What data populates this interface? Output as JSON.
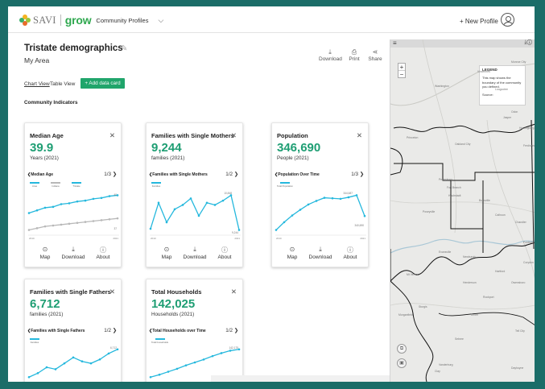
{
  "header": {
    "logo_savi": "SAVI",
    "logo_grow": "grow",
    "app_name": "Community Profiles",
    "new_profile": "+ New Profile"
  },
  "profile": {
    "title": "Tristate demographics",
    "subtitle": "My Area"
  },
  "toolbar": {
    "download": "Download",
    "print": "Print",
    "share": "Share"
  },
  "views": {
    "chart_view": "Chart View",
    "table_view": "Table View",
    "add_card": "+ Add data card"
  },
  "section_title": "Community Indicators",
  "card_actions": {
    "map": "Map",
    "download": "Download",
    "about": "About"
  },
  "cards": [
    {
      "title": "Median Age",
      "value": "39.9",
      "unit": "Years (2021)",
      "subchart": "Median Age",
      "pager": "1/3",
      "legend": [
        "Area",
        "Indiana",
        "Tristate"
      ],
      "end_label": "40",
      "end_label2": "37",
      "x_start": "2010",
      "x_end": "2021"
    },
    {
      "title": "Families with Single Mothers",
      "value": "9,244",
      "unit": "families (2021)",
      "subchart": "Families with Single Mothers",
      "pager": "1/2",
      "legend": [
        "Families"
      ],
      "peak_label": "10,848",
      "end_label": "9,244",
      "x_start": "2010",
      "x_end": "2021"
    },
    {
      "title": "Population",
      "value": "346,690",
      "unit": "People (2021)",
      "subchart": "Population Over Time",
      "pager": "1/3",
      "legend": [
        "Total Population"
      ],
      "peak_label": "344,687",
      "end_label": "340,690",
      "x_start": "2010",
      "x_end": "2021"
    },
    {
      "title": "Families with Single Fathers",
      "value": "6,712",
      "unit": "families (2021)",
      "subchart": "Families with Single Fathers",
      "pager": "1/2",
      "legend": [
        "Families"
      ],
      "end_label": "6,712"
    },
    {
      "title": "Total Households",
      "value": "142,025",
      "unit": "Households (2021)",
      "subchart": "Total Households over Time",
      "pager": "1/2",
      "legend": [
        "Total households"
      ],
      "end_label": "142,175"
    }
  ],
  "mini_series": {
    "median_age": [
      37.9,
      38.2,
      38.5,
      38.6,
      38.9,
      39.0,
      39.2,
      39.3,
      39.5,
      39.6,
      39.8,
      39.9
    ],
    "median_age_b": [
      36.0,
      36.2,
      36.4,
      36.5,
      36.6,
      36.7,
      36.8,
      36.9,
      37.0,
      37.1,
      37.2,
      37.3
    ],
    "single_mothers": [
      9300,
      10500,
      9600,
      10200,
      10400,
      10700,
      9900,
      10500,
      10400,
      10600,
      10848,
      9244
    ],
    "population": [
      338000,
      339500,
      340800,
      341900,
      342900,
      343600,
      344200,
      344100,
      344000,
      344300,
      344687,
      340690
    ],
    "single_fathers": [
      5300,
      5500,
      5800,
      5700,
      6000,
      6300,
      6100,
      6000,
      6200,
      6500,
      6712
    ],
    "households": [
      136500,
      137000,
      137600,
      138200,
      138900,
      139500,
      140100,
      140800,
      141400,
      141900,
      142175
    ]
  },
  "map": {
    "legend_title": "LEGEND",
    "legend_text": "This map shows the boundary of the community you defined.",
    "source": "Source:",
    "places": [
      "Monroe City",
      "Vincennes",
      "Washington",
      "Loogootee",
      "Odon",
      "Jasper",
      "Huntingburg",
      "Princeton",
      "Oakland City",
      "Ferdinand",
      "Petersburg",
      "Fort Branch",
      "Haubstadt",
      "Boonville",
      "Newburgh",
      "Chandler",
      "Evansville",
      "Morganfield",
      "Henderson",
      "Owensboro",
      "Sebree",
      "Poseyville",
      "Mt Vernon",
      "Corydon",
      "Rockport",
      "Tell City",
      "Dixon",
      "Vanderburg",
      "Dayhoyne",
      "Calhoun",
      "Fordsville",
      "Clay",
      "Sturgis",
      "Hartford"
    ],
    "zoom_in": "+",
    "zoom_out": "−"
  },
  "colors": {
    "accent_green": "#1e9e73",
    "button_green": "#20a56b",
    "series_blue": "#25b8dd",
    "series_gray": "#b8b8b8",
    "frame": "#1b6d68"
  },
  "icons": [
    "logo-leaf-icon",
    "chevron-down-icon",
    "avatar-icon",
    "pencil-icon",
    "download-icon",
    "print-icon",
    "share-icon",
    "close-icon",
    "chevron-left-icon",
    "chevron-right-icon",
    "map-pin-icon",
    "info-icon",
    "hamburger-icon",
    "screenshot-icon",
    "select-icon"
  ]
}
